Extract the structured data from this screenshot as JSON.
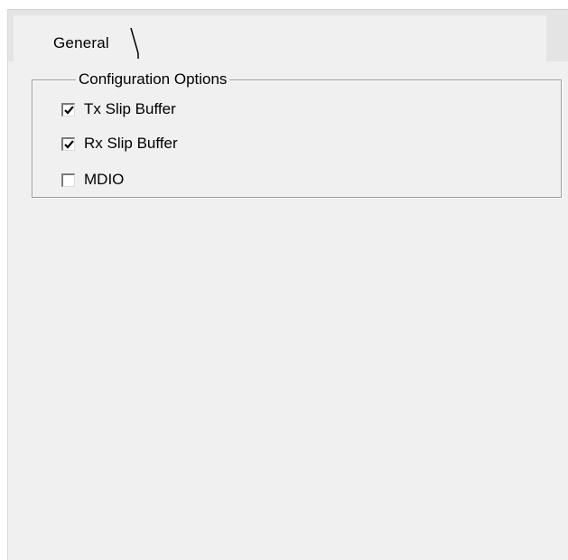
{
  "tabs": [
    {
      "label": "General",
      "active": true
    }
  ],
  "group": {
    "title": "Configuration Options",
    "options": [
      {
        "label": "Tx Slip Buffer",
        "checked": true
      },
      {
        "label": "Rx Slip Buffer",
        "checked": true
      },
      {
        "label": "MDIO",
        "checked": false
      }
    ]
  },
  "colors": {
    "panel": "#f0f0f0",
    "border": "#9c9c9c"
  },
  "icons": {
    "checkmark": "check-icon"
  }
}
